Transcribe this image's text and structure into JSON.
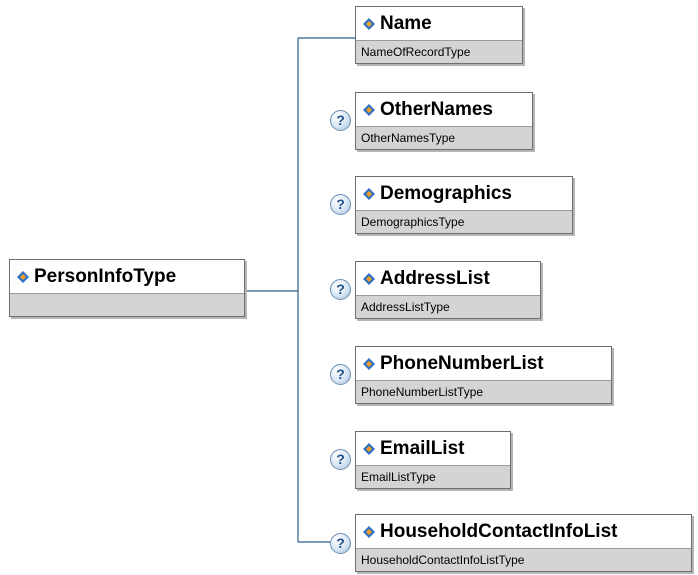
{
  "root": {
    "name": "PersonInfoType",
    "type": ""
  },
  "optional_marker": "?",
  "children": [
    {
      "name": "Name",
      "type": "NameOfRecordType",
      "optional": false
    },
    {
      "name": "OtherNames",
      "type": "OtherNamesType",
      "optional": true
    },
    {
      "name": "Demographics",
      "type": "DemographicsType",
      "optional": true
    },
    {
      "name": "AddressList",
      "type": "AddressListType",
      "optional": true
    },
    {
      "name": "PhoneNumberList",
      "type": "PhoneNumberListType",
      "optional": true
    },
    {
      "name": "EmailList",
      "type": "EmailListType",
      "optional": true
    },
    {
      "name": "HouseholdContactInfoList",
      "type": "HouseholdContactInfoListType",
      "optional": true
    }
  ],
  "colors": {
    "connector": "#2f5d8a",
    "icon_blue": "#2e6fc4",
    "icon_orange": "#f0a020",
    "type_band": "#d4d4d4"
  }
}
